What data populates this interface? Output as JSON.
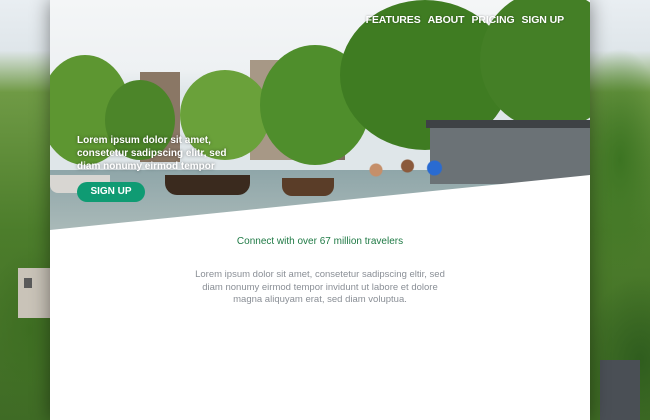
{
  "nav": {
    "items": [
      {
        "label": "FEATURES"
      },
      {
        "label": "ABOUT"
      },
      {
        "label": "PRICING"
      },
      {
        "label": "SIGN UP"
      }
    ]
  },
  "hero": {
    "text": "Lorem ipsum dolor sit amet, consetetur sadipscing elitr, sed diam nonumy eirmod tempor",
    "cta_label": "SIGN UP"
  },
  "content": {
    "tagline": "Connect with over 67 million travelers",
    "blurb": "Lorem ipsum dolor sit amet, consetetur sadipscing eltir, sed diam nonumy eirmod tempor invidunt ut labore et dolore magna aliquyam erat, sed diam voluptua."
  },
  "colors": {
    "accent": "#0f9b73",
    "tagline": "#1f7a45",
    "body_text": "#8a8f96"
  }
}
